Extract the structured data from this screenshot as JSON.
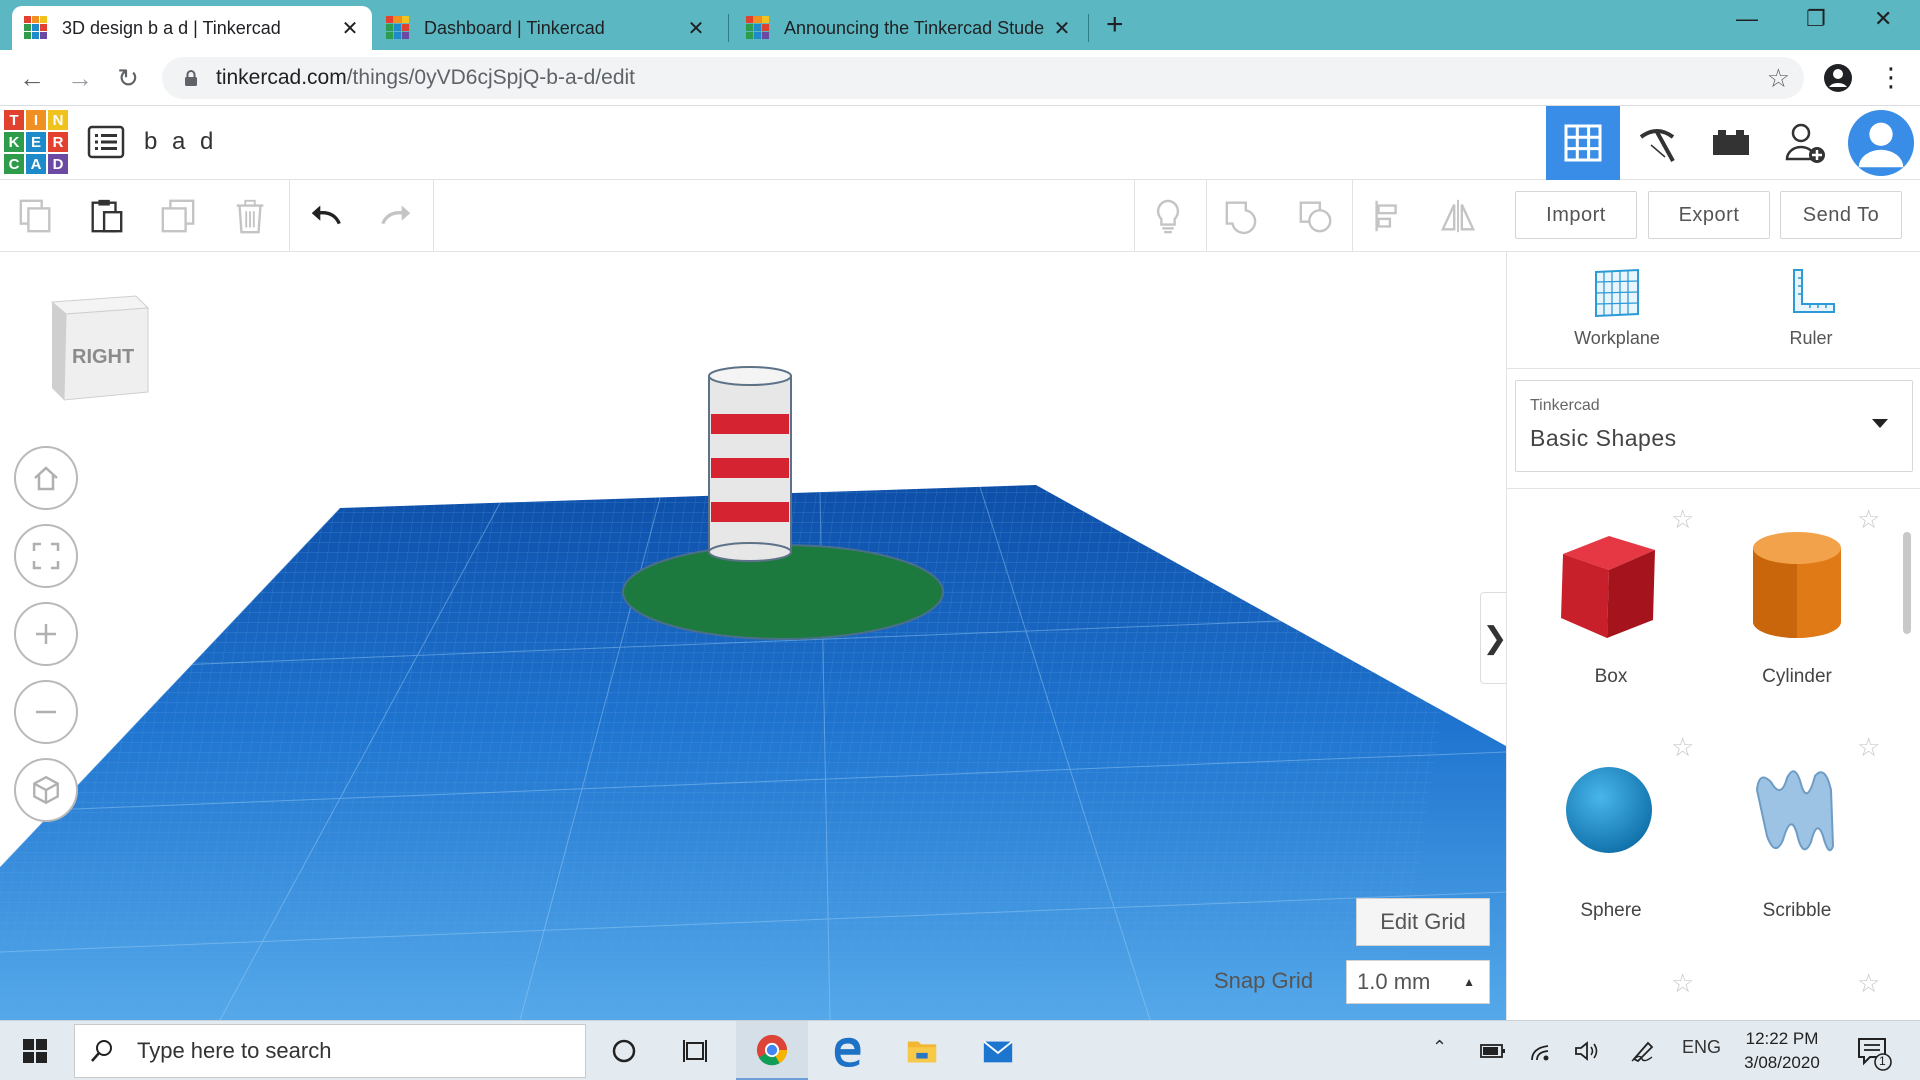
{
  "browser": {
    "tabs": [
      {
        "title": "3D design b a d | Tinkercad",
        "active": true
      },
      {
        "title": "Dashboard | Tinkercad",
        "active": false
      },
      {
        "title": "Announcing the Tinkercad Stude",
        "active": false
      }
    ],
    "new_tab": "+",
    "close_glyph": "✕",
    "url_host": "tinkercad.com",
    "url_path": "/things/0yVD6cjSpjQ-b-a-d/edit"
  },
  "logo": {
    "letters": [
      "T",
      "I",
      "N",
      "K",
      "E",
      "R",
      "C",
      "A",
      "D"
    ],
    "colors": [
      "#e2412f",
      "#f08f22",
      "#f0c21e",
      "#2d9d4c",
      "#1d8bc9",
      "#e2412f",
      "#2d9d4c",
      "#1d8bc9",
      "#6c49a3"
    ]
  },
  "header": {
    "design_name": "b a d"
  },
  "toolbar": {
    "import_label": "Import",
    "export_label": "Export",
    "send_to_label": "Send To"
  },
  "viewport": {
    "viewcube_label": "RIGHT",
    "edit_grid_label": "Edit Grid",
    "snap_grid_label": "Snap Grid",
    "snap_grid_value": "1.0 mm",
    "collapse_glyph": "❯"
  },
  "panel": {
    "workplane_label": "Workplane",
    "ruler_label": "Ruler",
    "library_source": "Tinkercad",
    "library_name": "Basic Shapes",
    "shapes": [
      {
        "name": "Box",
        "color": "#c8202a"
      },
      {
        "name": "Cylinder",
        "color": "#e07a16"
      },
      {
        "name": "Sphere",
        "color": "#1793cf"
      },
      {
        "name": "Scribble",
        "color": "#9cc3e4"
      }
    ]
  },
  "taskbar": {
    "search_placeholder": "Type here to search",
    "language": "ENG",
    "time": "12:22 PM",
    "date": "3/08/2020",
    "notification_count": "1"
  },
  "colors": {
    "tab_strip": "#5bb8c2",
    "accent_blue": "#3a8de6",
    "workplane_blue": "#1d6fc9",
    "base_green": "#1d7a3e",
    "stripe_red": "#d52332"
  }
}
